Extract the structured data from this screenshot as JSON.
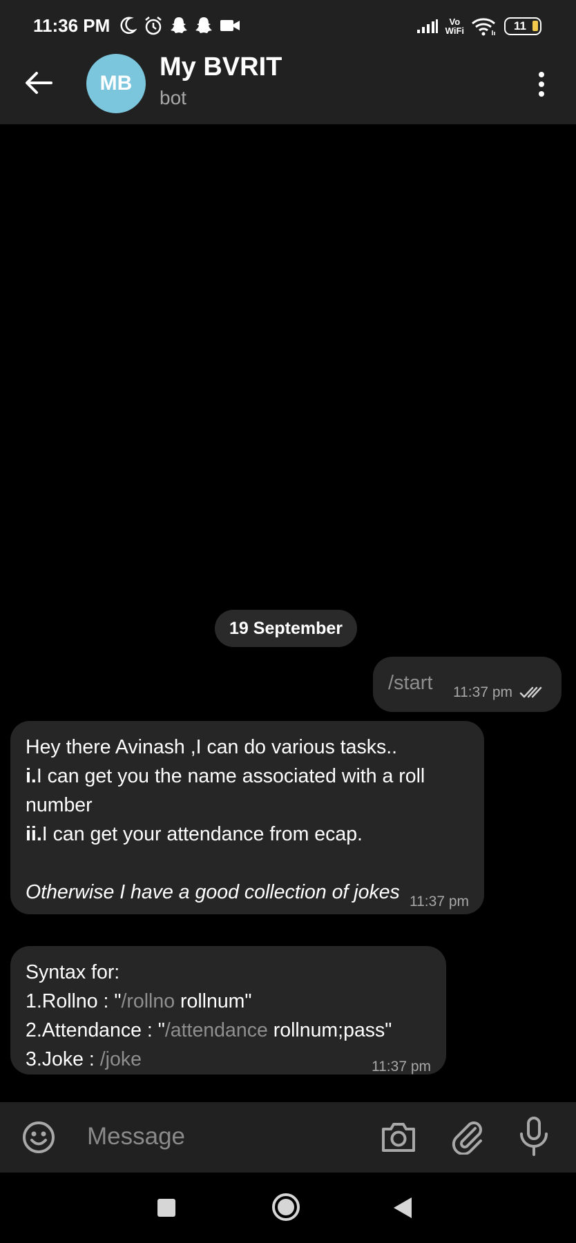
{
  "status_bar": {
    "time": "11:36 PM",
    "network_label_top": "Vo",
    "network_label_bottom": "WiFi",
    "battery": "11",
    "icons": [
      "moon-icon",
      "alarm-icon",
      "snapchat-icon",
      "snapchat-icon",
      "video-camera-icon",
      "signal-icon",
      "vowifi-icon",
      "wifi-icon",
      "battery-icon"
    ]
  },
  "header": {
    "avatar_initials": "MB",
    "title": "My BVRIT",
    "subtitle": "bot"
  },
  "chat": {
    "date_separator": "19 September",
    "messages": [
      {
        "direction": "outgoing",
        "text": "/start",
        "time": "11:37 pm",
        "status": "read"
      },
      {
        "direction": "incoming",
        "lines": [
          {
            "text": "Hey there Avinash ,I can do various tasks.."
          },
          {
            "bold": "i.",
            "text": "I can get you the name associated with a roll"
          },
          {
            "text": "number"
          },
          {
            "bold": "ii.",
            "text": "I can get your attendance from ecap."
          },
          {
            "italic": "Otherwise I have a good collection of jokes"
          }
        ],
        "time": "11:37 pm"
      },
      {
        "direction": "incoming",
        "lines": [
          {
            "text": "Syntax for:"
          },
          {
            "prefix": "1.Rollno : \"",
            "cmd": "/rollno",
            "suffix": " rollnum\""
          },
          {
            "prefix": "2.Attendance : \"",
            "cmd": "/attendance",
            "suffix": " rollnum;pass\""
          },
          {
            "prefix": "3.Joke : ",
            "cmd": "/joke"
          }
        ],
        "time": "11:37 pm"
      }
    ]
  },
  "composer": {
    "placeholder": "Message"
  },
  "colors": {
    "background": "#000000",
    "bar": "#212121",
    "bubble": "#262626",
    "avatar": "#7bc6dc",
    "command_text": "#8f8f8f",
    "battery_fill": "#f2c94c"
  }
}
